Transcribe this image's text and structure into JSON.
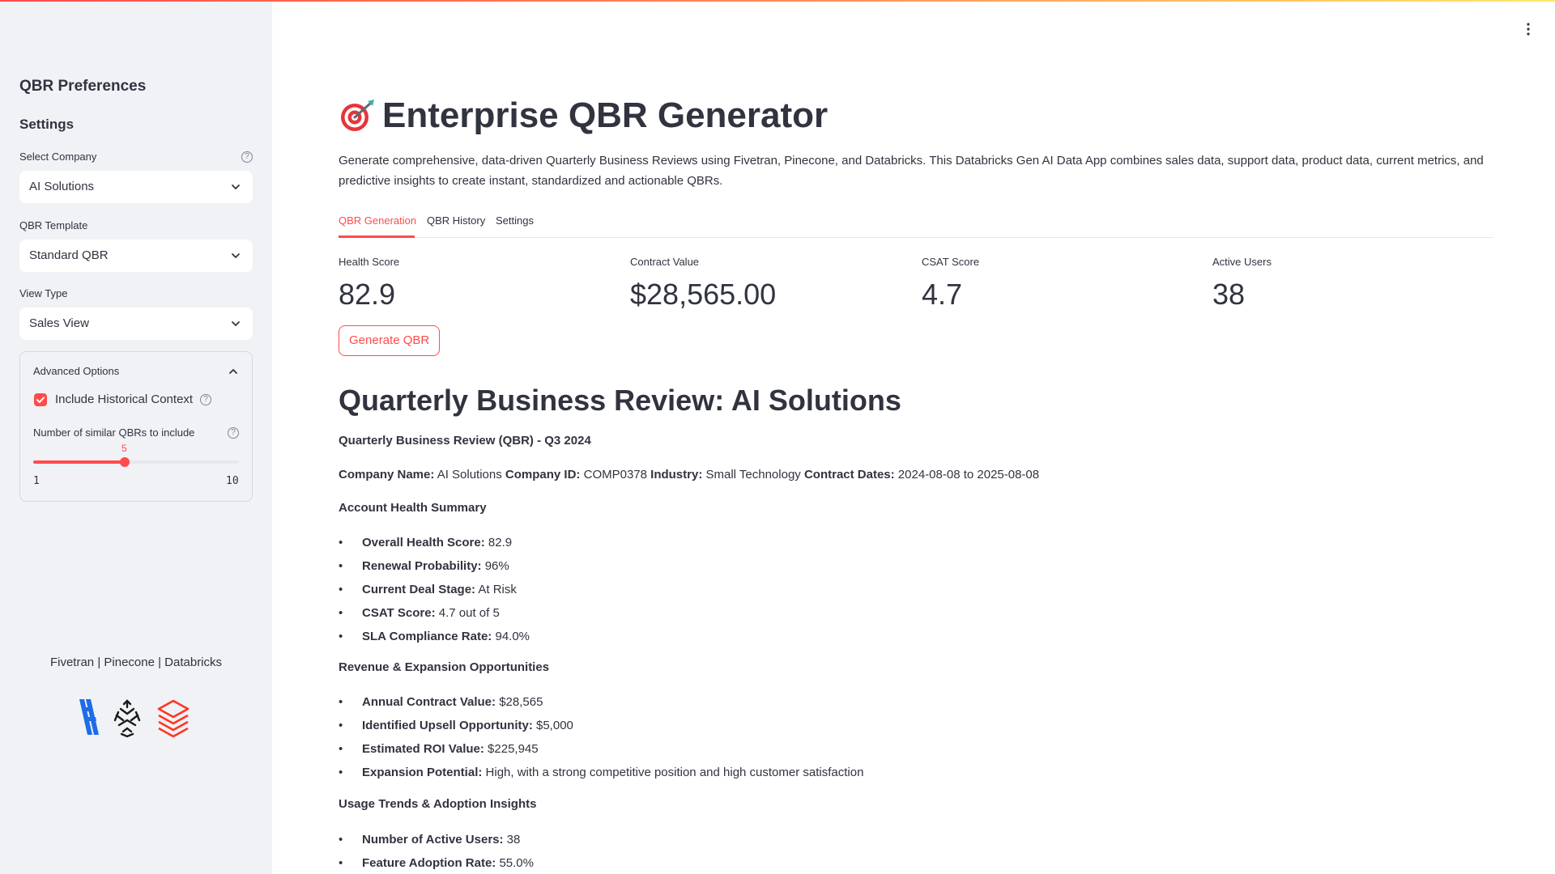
{
  "sidebar": {
    "heading": "QBR Preferences",
    "settings_heading": "Settings",
    "company": {
      "label": "Select Company",
      "value": "AI Solutions"
    },
    "template": {
      "label": "QBR Template",
      "value": "Standard QBR"
    },
    "view_type": {
      "label": "View Type",
      "value": "Sales View"
    },
    "advanced": {
      "title": "Advanced Options",
      "expanded": true,
      "historical_context": {
        "label": "Include Historical Context",
        "checked": true
      },
      "similar_qbrs": {
        "label": "Number of similar QBRs to include",
        "value": "5",
        "min": "1",
        "max": "10",
        "fraction": 0.444
      }
    },
    "footer_text": "Fivetran | Pinecone | Databricks",
    "logos": [
      "fivetran-logo",
      "pinecone-logo",
      "databricks-logo"
    ]
  },
  "main": {
    "title": "Enterprise QBR Generator",
    "description": "Generate comprehensive, data-driven Quarterly Business Reviews using Fivetran, Pinecone, and Databricks. This Databricks Gen AI Data App combines sales data, support data, product data, current metrics, and predictive insights to create instant, standardized and actionable QBRs.",
    "tabs": [
      "QBR Generation",
      "QBR History",
      "Settings"
    ],
    "metrics": [
      {
        "label": "Health Score",
        "value": "82.9"
      },
      {
        "label": "Contract Value",
        "value": "$28,565.00"
      },
      {
        "label": "CSAT Score",
        "value": "4.7"
      },
      {
        "label": "Active Users",
        "value": "38"
      }
    ],
    "generate_button": "Generate QBR",
    "report": {
      "heading": "Quarterly Business Review: AI Solutions",
      "subtitle": "Quarterly Business Review (QBR) - Q3 2024",
      "info": [
        {
          "k": "Company Name:",
          "v": " AI Solutions "
        },
        {
          "k": "Company ID:",
          "v": " COMP0378 "
        },
        {
          "k": "Industry:",
          "v": " Small Technology "
        },
        {
          "k": "Contract Dates:",
          "v": " 2024-08-08 to 2025-08-08"
        }
      ],
      "sections": [
        {
          "title": "Account Health Summary",
          "items": [
            {
              "k": "Overall Health Score:",
              "v": " 82.9"
            },
            {
              "k": "Renewal Probability:",
              "v": " 96%"
            },
            {
              "k": "Current Deal Stage:",
              "v": " At Risk"
            },
            {
              "k": "CSAT Score:",
              "v": " 4.7 out of 5"
            },
            {
              "k": "SLA Compliance Rate:",
              "v": " 94.0%"
            }
          ]
        },
        {
          "title": "Revenue & Expansion Opportunities",
          "items": [
            {
              "k": "Annual Contract Value:",
              "v": " $28,565"
            },
            {
              "k": "Identified Upsell Opportunity:",
              "v": " $5,000"
            },
            {
              "k": "Estimated ROI Value:",
              "v": " $225,945"
            },
            {
              "k": "Expansion Potential:",
              "v": " High, with a strong competitive position and high customer satisfaction"
            }
          ]
        },
        {
          "title": "Usage Trends & Adoption Insights",
          "items": [
            {
              "k": "Number of Active Users:",
              "v": " 38"
            },
            {
              "k": "Feature Adoption Rate:",
              "v": " 55.0%"
            }
          ]
        }
      ]
    }
  },
  "colors": {
    "accent": "#ff4b4b",
    "sidebar_bg": "#f0f2f6",
    "text": "#31333f"
  }
}
